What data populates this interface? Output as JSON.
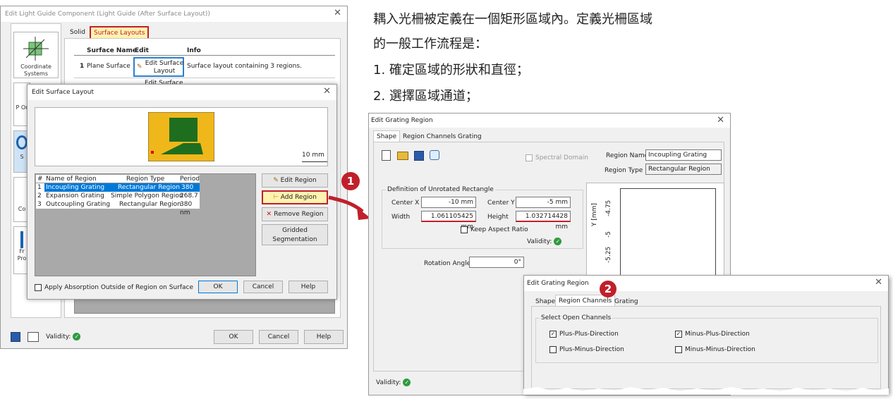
{
  "main_window": {
    "title": "Edit Light Guide Component (Light Guide (After Surface Layout))",
    "tabs": [
      "Solid",
      "Surface Layouts"
    ],
    "sidebar": [
      "Coordinate Systems",
      "P Or",
      "S",
      "Co",
      "Fr Pro"
    ],
    "table_headers": [
      "Surface Name",
      "Edit",
      "Info"
    ],
    "rows": [
      {
        "num": "1",
        "name": "Plane Surface",
        "edit": "Edit Surface Layout",
        "info": "Surface layout containing 3 regions."
      },
      {
        "num": "",
        "name": "",
        "edit": "Edit Surface",
        "info": ""
      }
    ],
    "validity_label": "Validity:",
    "ok": "OK",
    "cancel": "Cancel",
    "help": "Help"
  },
  "surface_dialog": {
    "title": "Edit Surface Layout",
    "scale_label": "10 mm",
    "region_headers": [
      "#",
      "Name of Region",
      "Region Type",
      "Period"
    ],
    "regions": [
      {
        "num": "1",
        "name": "Incoupling Grating",
        "type": "Rectangular Region",
        "period": "380 nm"
      },
      {
        "num": "2",
        "name": "Expansion Grating",
        "type": "Simple Polygon Region",
        "period": "268.7 nm"
      },
      {
        "num": "3",
        "name": "Outcoupling Grating",
        "type": "Rectangular Region",
        "period": "380 nm"
      }
    ],
    "edit_region": "Edit Region",
    "add_region": "Add Region",
    "remove_region": "Remove Region",
    "gridded": "Gridded Segmentation",
    "absorption": "Apply Absorption Outside of Region on Surface",
    "ok": "OK",
    "cancel": "Cancel",
    "help": "Help"
  },
  "text_lines": [
    "耦入光柵被定義在一個矩形區域內。定義光柵區域",
    "的一般工作流程是：",
    "1. 確定區域的形狀和直徑；",
    "2. 選擇區域通道；"
  ],
  "badges": [
    "1",
    "2"
  ],
  "grating_dialog": {
    "title": "Edit Grating Region",
    "tabs": [
      "Shape",
      "Region Channels",
      "Grating"
    ],
    "spectral_domain": "Spectral Domain",
    "region_name_label": "Region Name",
    "region_name_value": "Incoupling Grating",
    "region_type_label": "Region Type",
    "region_type_value": "Rectangular Region",
    "definition_title": "Definition of Unrotated Rectangle",
    "center_x_label": "Center X",
    "center_x_value": "-10 mm",
    "center_y_label": "Center Y",
    "center_y_value": "-5 mm",
    "width_label": "Width",
    "width_value": "1.061105425 mm",
    "height_label": "Height",
    "height_value": "1.032714428 mm",
    "keep_aspect": "Keep Aspect Ratio",
    "validity_label": "Validity:",
    "rotation_label": "Rotation Angle",
    "rotation_value": "0°",
    "axis_label": "Y [mm]",
    "ticks": [
      "-4.75",
      "-5",
      "-5.25"
    ]
  },
  "channels_dialog": {
    "title": "Edit Grating Region",
    "tabs": [
      "Shape",
      "Region Channels",
      "Grating"
    ],
    "group_title": "Select Open Channels",
    "channels": [
      {
        "label": "Plus-Plus-Direction",
        "checked": true
      },
      {
        "label": "Minus-Plus-Direction",
        "checked": true
      },
      {
        "label": "Plus-Minus-Direction",
        "checked": false
      },
      {
        "label": "Minus-Minus-Direction",
        "checked": false
      }
    ]
  },
  "colors": {
    "highlight": "#c0202a",
    "selection": "#0078d7",
    "preview_bg": "#f0b71a",
    "region_green": "#1f6e1f"
  }
}
